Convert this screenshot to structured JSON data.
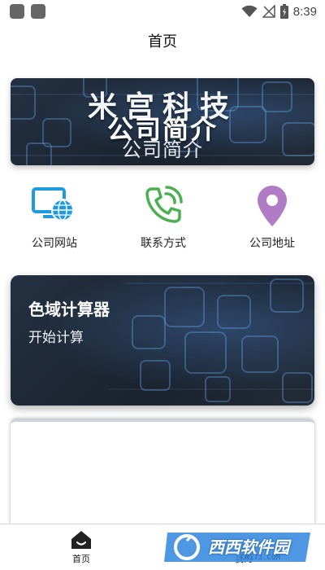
{
  "status_bar": {
    "time": "8:39",
    "icons": [
      "notification-square-icon",
      "notification-square-icon",
      "wifi-icon",
      "no-signal-icon",
      "battery-icon"
    ]
  },
  "header": {
    "title": "首页"
  },
  "banner": {
    "brand": "米宫科技",
    "subtitle_large": "公司简介",
    "subtitle_small": "公司简介"
  },
  "quick_links": [
    {
      "label": "公司网站",
      "icon": "website-monitor-icon",
      "color": "#1e9be0"
    },
    {
      "label": "联系方式",
      "icon": "phone-call-icon",
      "color": "#4caf50"
    },
    {
      "label": "公司地址",
      "icon": "location-pin-icon",
      "color": "#b07cc6"
    }
  ],
  "calculator_card": {
    "title": "色域计算器",
    "action": "开始计算"
  },
  "bottom_nav": {
    "home_label": "首页",
    "mine_label": "我的",
    "active_color": "#222222"
  },
  "watermark": {
    "brand": "西西软件园",
    "url": "CR173.COM"
  }
}
